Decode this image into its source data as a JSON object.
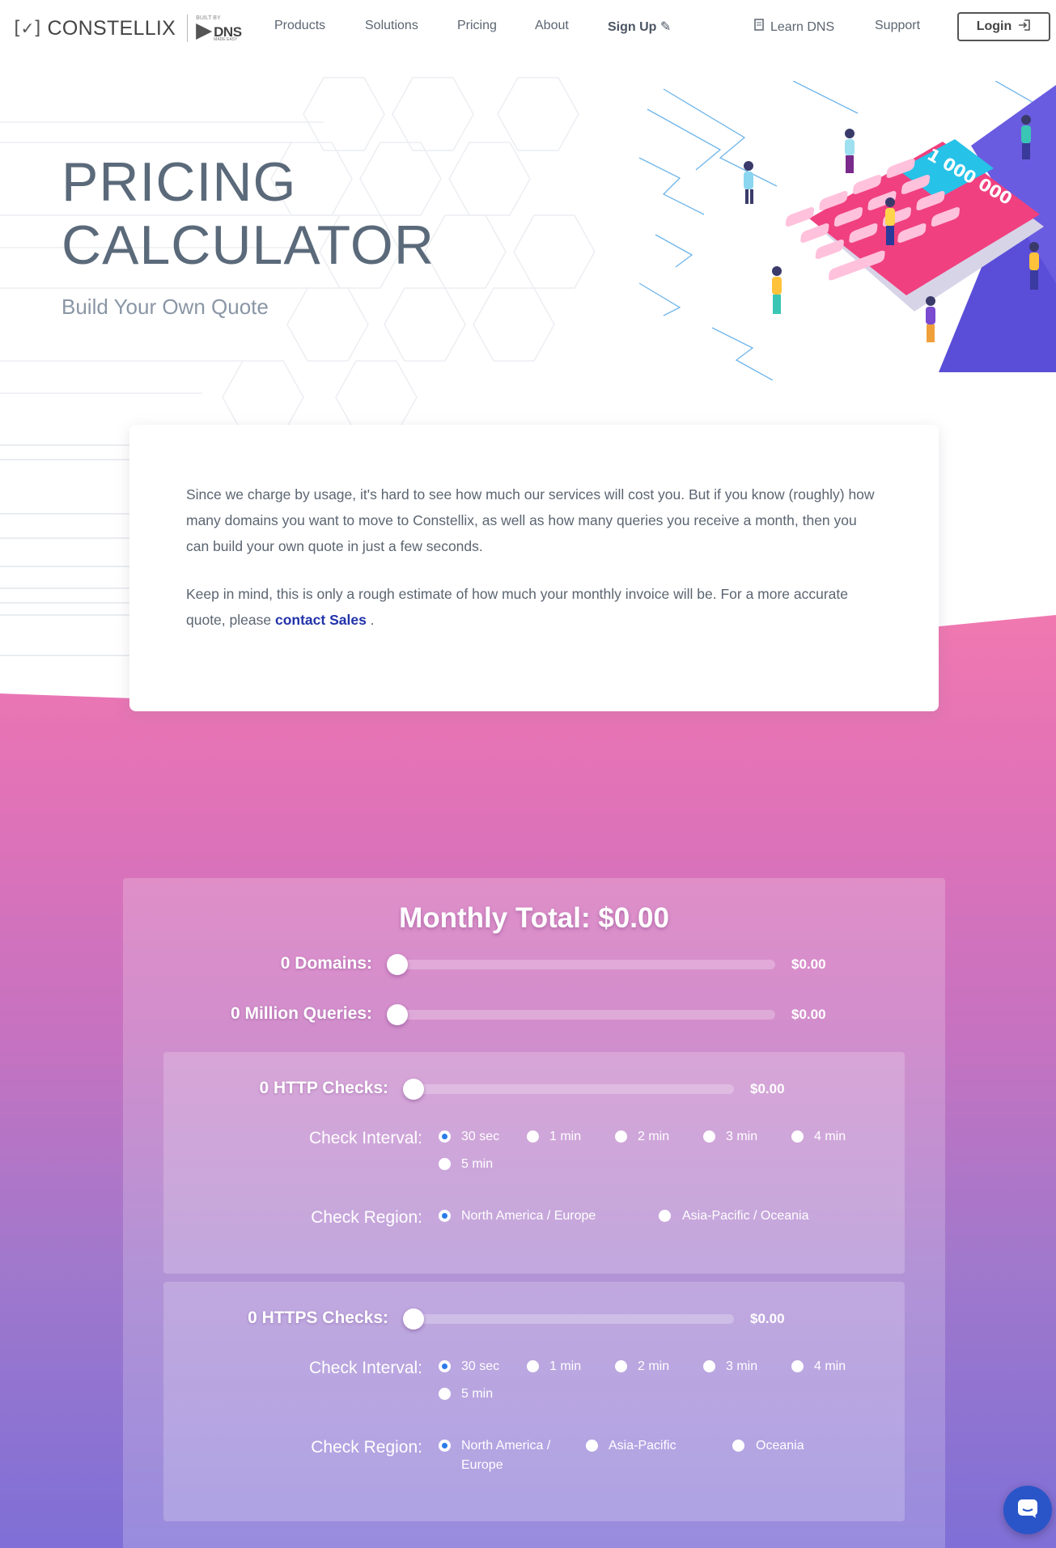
{
  "nav": {
    "logo_text": "CONSTELLIX",
    "built_by": "BUILT BY",
    "dns": "DNS",
    "made_easy": "MADE EASY",
    "items": [
      "Products",
      "Solutions",
      "Pricing",
      "About"
    ],
    "signup": "Sign Up",
    "learn_dns": "Learn DNS",
    "support": "Support",
    "login": "Login"
  },
  "hero": {
    "title_line1": "PRICING",
    "title_line2": "CALCULATOR",
    "subtitle": "Build Your Own Quote",
    "calc_display": "1 000 000"
  },
  "intro": {
    "p1": "Since we charge by usage, it's hard to see how much our services will cost you. But if you know (roughly) how many domains you want to move to Constellix, as well as how many queries you receive a month, then you can build your own quote in just a few seconds.",
    "p2_before": "Keep in mind, this is only a rough estimate of how much your monthly invoice will be. For a more accurate quote, please",
    "p2_link": "contact Sales",
    "p2_after": " ."
  },
  "calculator": {
    "monthly_total": "Monthly Total: $0.00",
    "domains": {
      "label": "0 Domains:",
      "price": "$0.00",
      "value": 0
    },
    "queries": {
      "label": "0 Million Queries:",
      "price": "$0.00",
      "value": 0
    },
    "http": {
      "label": "0 HTTP Checks:",
      "price": "$0.00",
      "value": 0,
      "interval_label": "Check Interval:",
      "intervals": [
        "30 sec",
        "1 min",
        "2 min",
        "3 min",
        "4 min",
        "5 min"
      ],
      "selected_interval": "30 sec",
      "region_label": "Check Region:",
      "regions": [
        "North America / Europe",
        "Asia-Pacific / Oceania"
      ],
      "selected_region": "North America / Europe"
    },
    "https": {
      "label": "0 HTTPS Checks:",
      "price": "$0.00",
      "value": 0,
      "interval_label": "Check Interval:",
      "intervals": [
        "30 sec",
        "1 min",
        "2 min",
        "3 min",
        "4 min",
        "5 min"
      ],
      "selected_interval": "30 sec",
      "region_label": "Check Region:",
      "regions": [
        "North America / Europe",
        "Asia-Pacific",
        "Oceania"
      ],
      "selected_region": "North America / Europe"
    }
  },
  "colors": {
    "accent": "#2233aa",
    "gradient_top": "#f078b0",
    "gradient_bottom": "#7f6fd6",
    "radio_selected": "#2b7bea",
    "calculator_pink": "#f0407f",
    "calculator_screen": "#27c2e8"
  },
  "icons": {
    "signup": "pencil-icon",
    "learn_dns": "book-icon",
    "login": "login-arrow-icon",
    "chat": "chat-icon"
  }
}
